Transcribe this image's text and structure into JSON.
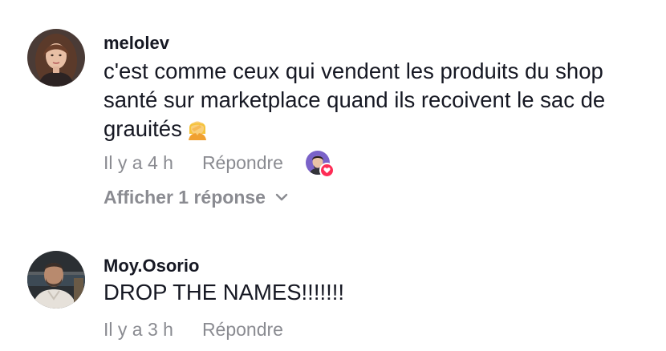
{
  "comments": [
    {
      "username": "melolev",
      "avatar_icon": "woman-portrait-avatar",
      "text": "c'est comme ceux qui vendent les produits du shop\nsanté sur marketplace quand ils recoivent le sac de\ngrauités",
      "emoji_icon": "woman-facepalming-emoji",
      "time": "Il y a 4 h",
      "reply_label": "Répondre",
      "liked_by_icon": "creator-avatar-with-heart",
      "view_replies_label": "Afficher 1 réponse"
    },
    {
      "username": "Moy.Osorio",
      "avatar_icon": "man-portrait-avatar",
      "text": "DROP THE NAMES!!!!!!!",
      "time": "Il y a 3 h",
      "reply_label": "Répondre"
    }
  ],
  "colors": {
    "text": "#161823",
    "secondary": "#8a8b91",
    "heart": "#fe2c55"
  }
}
